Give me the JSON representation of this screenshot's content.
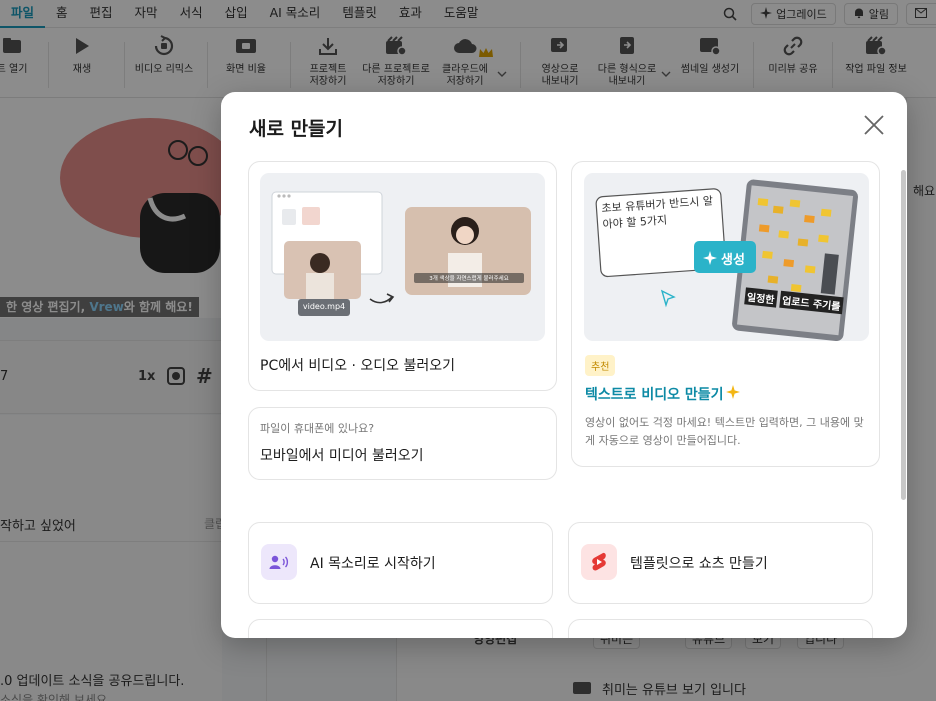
{
  "menu": {
    "tabs": [
      "파일",
      "홈",
      "편집",
      "자막",
      "서식",
      "삽입",
      "AI 목소리",
      "템플릿",
      "효과",
      "도움말"
    ],
    "upgrade": "업그레이드",
    "notification": "알림"
  },
  "toolbar": {
    "items": [
      "트 열기",
      "재생",
      "비디오 리믹스",
      "화면 비율",
      "프로젝트\n저장하기",
      "다른 프로젝트로\n저장하기",
      "클라우드에\n저장하기",
      "영상으로\n내보내기",
      "다른 형식으로\n내보내기",
      "썸네일 생성기",
      "미리뷰 공유",
      "작업 파일 정보"
    ]
  },
  "background": {
    "caption_prefix": "한 영상 편집기, ",
    "caption_brand": "Vrew",
    "caption_suffix": "와 함께 해요!",
    "player_left": "7",
    "player_speed": "1x",
    "list_item_1": "작하고 싶었어",
    "list_item_1_action": "클립",
    "list_item_2": ".0 업데이트 소식을 공유드립니다.",
    "list_item_2_sub": "소식을 확인해 보세요",
    "right_side_label": "해요",
    "right_row_1_label": "잉잉편집",
    "right_row_1_chips": [
      "취미는",
      "유튜브",
      "보기",
      "입니다"
    ],
    "right_row_2_text": "취미는 유튜브 보기 입니다"
  },
  "modal": {
    "title": "새로 만들기",
    "pc_import": {
      "title": "PC에서 비디오 · 오디오 불러오기",
      "file_label": "video.mp4",
      "thumb_caption": "3개 색상을 자연스럽게 불러주세요"
    },
    "mobile_import": {
      "subtitle": "파일이 휴대폰에 있나요?",
      "title": "모바일에서 미디어 불러오기"
    },
    "text_to_video": {
      "prompt_text": "초보 유튜버가 반드시 알아야 할 5가지",
      "generate_label": "생성",
      "image_caption_1": "일정한",
      "image_caption_2": "업로드 주기를",
      "badge": "추천",
      "title": "텍스트로 비디오 만들기",
      "description": "영상이 없어도 걱정 마세요! 텍스트만 입력하면, 그 내용에 맞게 자동으로 영상이 만들어집니다."
    },
    "ai_voice": {
      "title": "AI 목소리로 시작하기"
    },
    "template_shorts": {
      "title": "템플릿으로 쇼츠 만들기"
    }
  },
  "colors": {
    "accent": "#1a9bbd",
    "teal_title": "#0d8aa5",
    "generate_button": "#2bb3c9",
    "badge_bg": "#fff2c8",
    "ai_voice_icon_bg": "#ede7fb",
    "template_icon_bg": "#fde3e3",
    "upgrade_star": "#d9a300"
  }
}
